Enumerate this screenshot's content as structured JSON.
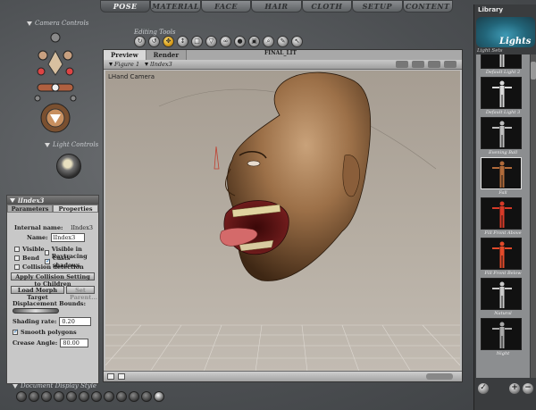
{
  "tabs": [
    {
      "label": "POSE",
      "active": true
    },
    {
      "label": "MATERIAL",
      "active": false
    },
    {
      "label": "FACE",
      "active": false
    },
    {
      "label": "HAIR",
      "active": false
    },
    {
      "label": "CLOTH",
      "active": false
    },
    {
      "label": "SETUP",
      "active": false
    },
    {
      "label": "CONTENT",
      "active": false
    }
  ],
  "left": {
    "camera_controls_label": "Camera Controls",
    "light_controls_label": "Light Controls",
    "document_display_label": "Document Display Style"
  },
  "editing_tools": {
    "label": "Editing Tools",
    "icons": [
      "rotate-icon",
      "twist-icon",
      "translate-icon",
      "translate-in-out-icon",
      "scale-icon",
      "taper-icon",
      "chain-break-icon",
      "color-icon",
      "grouping-icon",
      "view-magnifier-icon",
      "morph-brush-icon",
      "direct-manipulation-icon"
    ]
  },
  "document": {
    "tabs": [
      {
        "label": "Preview"
      },
      {
        "label": "Render"
      }
    ],
    "title": "FINAL_LIT",
    "figure_menu": "Figure 1",
    "actor_menu": "lIndex3",
    "camera_label": "LHand Camera"
  },
  "properties": {
    "title": "lIndex3",
    "tabs": [
      "Parameters",
      "Properties"
    ],
    "internal_name_label": "Internal name:",
    "internal_name_value": "lIndex3",
    "name_label": "Name:",
    "name_value": "lIndex3",
    "visible_label": "Visible",
    "visible_raytracing_label": "Visible in Raytracing",
    "bend_label": "Bend",
    "casts_shadows_label": "Casts shadows",
    "collision_label": "Collision detection",
    "apply_collision_button": "Apply Collision Setting to Children",
    "load_morph_button": "Load Morph Target",
    "set_parent_button": "Set Parent...",
    "displacement_label": "Displacement Bounds:",
    "shading_rate_label": "Shading rate:",
    "shading_rate_value": "0.20",
    "smooth_polygons_label": "Smooth polygons",
    "crease_angle_label": "Crease Angle:",
    "crease_angle_value": "80.00"
  },
  "library": {
    "title": "Library",
    "category": "Lights",
    "subheader": "Light Sets",
    "items": [
      {
        "name": "Default Light 2",
        "color": "#cfcfcf"
      },
      {
        "name": "Default Light 3",
        "color": "#d8d8d8"
      },
      {
        "name": "Evening Ball",
        "color": "#bdbdbd"
      },
      {
        "name": "Fall",
        "color": "#b06a3a"
      },
      {
        "name": "Fill Front Above",
        "color": "#d63a28"
      },
      {
        "name": "Fill Front Below",
        "color": "#e24a2a"
      },
      {
        "name": "Natural",
        "color": "#c9c9c9"
      },
      {
        "name": "Night",
        "color": "#a8a8a8"
      }
    ]
  }
}
